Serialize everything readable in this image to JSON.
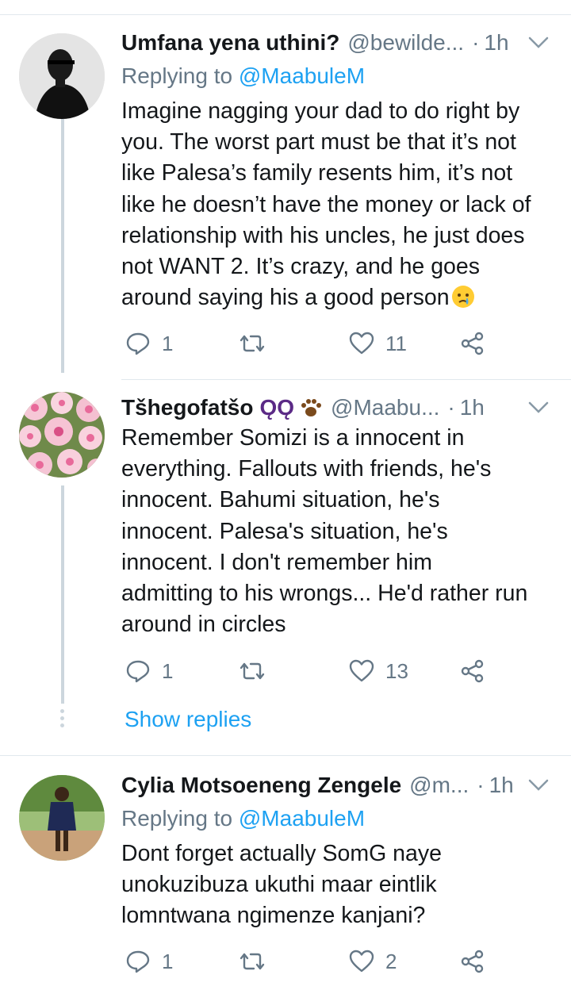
{
  "colors": {
    "link": "#1da1f2",
    "muted": "#657786",
    "text": "#14171a",
    "thread": "#ccd6dd"
  },
  "tweets": [
    {
      "name": "Umfana yena uthini?",
      "handle": "@bewilde...",
      "time": "1h",
      "replying_label": "Replying to",
      "replying_to": "@MaabuleM",
      "lines": [
        "Imagine nagging your dad to do right by",
        "you. The worst part must be that it’s not",
        "like Palesa’s family resents him, it’s not",
        "like he doesn’t have the money or lack of",
        "relationship with his uncles, he just does",
        "not WANT 2. It’s crazy, and he goes",
        "around saying his a good person"
      ],
      "emoji": "crying-face-emoji",
      "replies": "1",
      "retweets": "",
      "likes": "11"
    },
    {
      "name": "Tšhegofatšo",
      "name_decor": "ǪǪ",
      "handle": "@Maabu...",
      "time": "1h",
      "lines": [
        "Remember Somizi is a innocent in",
        "everything. Fallouts with friends, he's",
        "innocent. Bahumi situation, he's",
        "innocent. Palesa's situation, he's",
        "innocent. I don't remember him",
        "admitting to his wrongs... He'd rather run",
        "around in circles"
      ],
      "replies": "1",
      "retweets": "",
      "likes": "13",
      "show_replies": "Show replies"
    },
    {
      "name": "Cylia Motsoeneng Zengele",
      "handle": "@m...",
      "time": "1h",
      "replying_label": "Replying to",
      "replying_to": "@MaabuleM",
      "lines": [
        "Dont forget actually SomG naye",
        "unokuzibuza ukuthi maar eintlik",
        "lomntwana ngimenze kanjani?"
      ],
      "replies": "1",
      "retweets": "",
      "likes": "2"
    }
  ],
  "separator": "·"
}
